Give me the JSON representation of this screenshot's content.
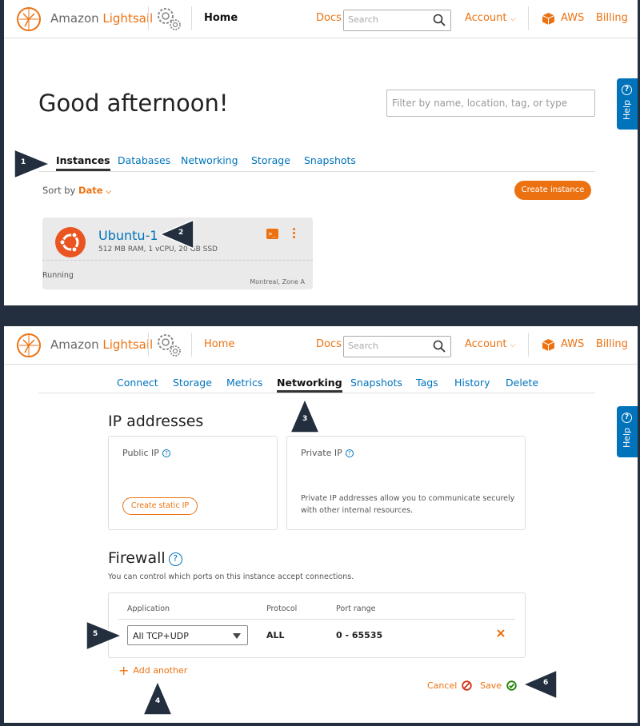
{
  "topbar": {
    "brand_prefix": "Amazon ",
    "brand_accent": "Lightsail",
    "home": "Home",
    "docs": "Docs",
    "search_placeholder": "Search",
    "account": "Account",
    "aws": "AWS",
    "billing": "Billing",
    "help": "Help"
  },
  "home_page": {
    "greeting": "Good afternoon!",
    "filter_placeholder": "Filter by name, location, tag, or type",
    "tabs": [
      "Instances",
      "Databases",
      "Networking",
      "Storage",
      "Snapshots"
    ],
    "active_tab": "Instances",
    "sort_prefix": "Sort by ",
    "sort_value": "Date",
    "create_instance": "Create instance",
    "instance": {
      "name": "Ubuntu-1",
      "specs": "512 MB RAM, 1 vCPU, 20 GB SSD",
      "status": "Running",
      "zone": "Montreal, Zone A",
      "terminal_icon": ">_"
    }
  },
  "instance_page": {
    "tabs": [
      "Connect",
      "Storage",
      "Metrics",
      "Networking",
      "Snapshots",
      "Tags",
      "History",
      "Delete"
    ],
    "active_tab": "Networking",
    "ip_title": "IP addresses",
    "public_ip_label": "Public IP",
    "create_static_ip": "Create static IP",
    "private_ip_label": "Private IP",
    "private_ip_desc": "Private IP addresses allow you to communicate securely with other internal resources.",
    "firewall_title": "Firewall",
    "firewall_desc": "You can control which ports on this instance accept connections.",
    "firewall_headers": [
      "Application",
      "Protocol",
      "Port range"
    ],
    "firewall_rule": {
      "application": "All TCP+UDP",
      "protocol": "ALL",
      "port_range": "0 - 65535"
    },
    "add_another": "Add another",
    "cancel": "Cancel",
    "save": "Save"
  },
  "markers": [
    "1",
    "2",
    "3",
    "4",
    "5",
    "6"
  ],
  "colors": {
    "accent": "#ec7211",
    "link": "#0073bb",
    "background": "#232f3e",
    "marker": "#232f3e"
  }
}
